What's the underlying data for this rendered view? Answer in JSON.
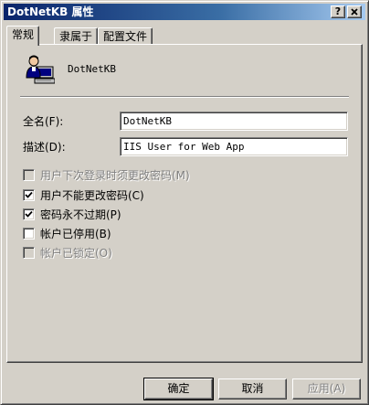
{
  "window": {
    "title": "DotNetKB 属性",
    "help_button": "?",
    "close_button": "X"
  },
  "tabs": [
    {
      "label": "常规",
      "active": true
    },
    {
      "label": "隶属于",
      "active": false
    },
    {
      "label": "配置文件",
      "active": false
    }
  ],
  "user": {
    "icon": "user-computer-icon",
    "name": "DotNetKB"
  },
  "fields": {
    "fullname_label": "全名(F):",
    "fullname_value": "DotNetKB",
    "description_label": "描述(D):",
    "description_value": "IIS User for Web App"
  },
  "options": [
    {
      "label": "用户下次登录时须更改密码(M)",
      "checked": false,
      "enabled": false
    },
    {
      "label": "用户不能更改密码(C)",
      "checked": true,
      "enabled": true
    },
    {
      "label": "密码永不过期(P)",
      "checked": true,
      "enabled": true
    },
    {
      "label": "帐户已停用(B)",
      "checked": false,
      "enabled": true
    },
    {
      "label": "帐户已锁定(O)",
      "checked": false,
      "enabled": false
    }
  ],
  "buttons": {
    "ok": "确定",
    "cancel": "取消",
    "apply": "应用(A)"
  },
  "colors": {
    "face": "#d4d0c8",
    "title_active": "#0a246a",
    "title_gradient_end": "#a6caf0",
    "disabled_text": "#808080"
  }
}
